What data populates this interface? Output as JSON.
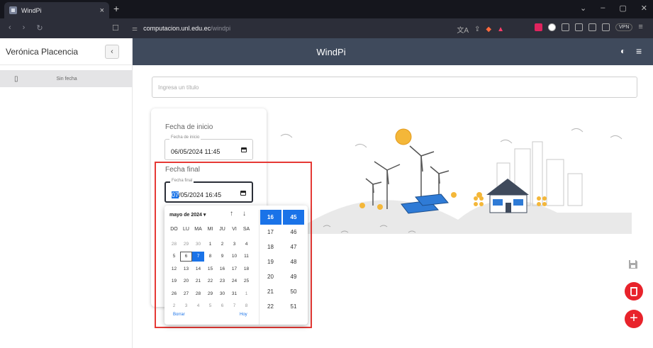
{
  "browser": {
    "tab_title": "WindPi",
    "tab_close": "×",
    "new_tab": "+",
    "url_domain": "computacion.unl.edu.ec",
    "url_path": "/windpi",
    "vpn_label": "VPN"
  },
  "sidebar": {
    "user_name": "Verónica Placencia",
    "collapse_icon": "‹",
    "items": [
      {
        "label": "Sin fecha",
        "icon": "bookmark-icon"
      }
    ]
  },
  "header": {
    "title": "WindPi"
  },
  "title_input": {
    "placeholder": "Ingresa un título",
    "value": ""
  },
  "start": {
    "section_label": "Fecha de inicio",
    "field_legend": "Fecha de inicio",
    "value": "06/05/2024 11:45"
  },
  "end": {
    "section_label": "Fecha final",
    "field_legend": "Fecha final",
    "value_selected": "07",
    "value_rest": "/05/2024 16:45"
  },
  "picker": {
    "month_label": "mayo de 2024 ▾",
    "weekdays": [
      "DO",
      "LU",
      "MA",
      "MI",
      "JU",
      "VI",
      "SA"
    ],
    "days": [
      {
        "d": "28",
        "out": true
      },
      {
        "d": "29",
        "out": true
      },
      {
        "d": "30",
        "out": true
      },
      {
        "d": "1"
      },
      {
        "d": "2"
      },
      {
        "d": "3"
      },
      {
        "d": "4"
      },
      {
        "d": "5"
      },
      {
        "d": "6",
        "today": true
      },
      {
        "d": "7",
        "selected": true
      },
      {
        "d": "8"
      },
      {
        "d": "9"
      },
      {
        "d": "10"
      },
      {
        "d": "11"
      },
      {
        "d": "12"
      },
      {
        "d": "13"
      },
      {
        "d": "14"
      },
      {
        "d": "15"
      },
      {
        "d": "16"
      },
      {
        "d": "17"
      },
      {
        "d": "18"
      },
      {
        "d": "19"
      },
      {
        "d": "20"
      },
      {
        "d": "21"
      },
      {
        "d": "22"
      },
      {
        "d": "23"
      },
      {
        "d": "24"
      },
      {
        "d": "25"
      },
      {
        "d": "26"
      },
      {
        "d": "27"
      },
      {
        "d": "28"
      },
      {
        "d": "29"
      },
      {
        "d": "30"
      },
      {
        "d": "31"
      },
      {
        "d": "1",
        "out": true
      },
      {
        "d": "2",
        "out": true
      },
      {
        "d": "3",
        "out": true
      },
      {
        "d": "4",
        "out": true
      },
      {
        "d": "5",
        "out": true
      },
      {
        "d": "6",
        "out": true
      },
      {
        "d": "7",
        "out": true
      },
      {
        "d": "8",
        "out": true
      }
    ],
    "hours": [
      "16",
      "17",
      "18",
      "19",
      "20",
      "21",
      "22"
    ],
    "minutes": [
      "45",
      "46",
      "47",
      "48",
      "49",
      "50",
      "51"
    ],
    "selected_hour": "16",
    "selected_minute": "45",
    "clear_label": "Borrar",
    "today_label": "Hoy"
  },
  "fab": {
    "add_label": "+"
  },
  "colors": {
    "header": "#3f4a5c",
    "accent": "#1a73e8",
    "danger": "#e8232b",
    "highlight": "#e53935"
  }
}
